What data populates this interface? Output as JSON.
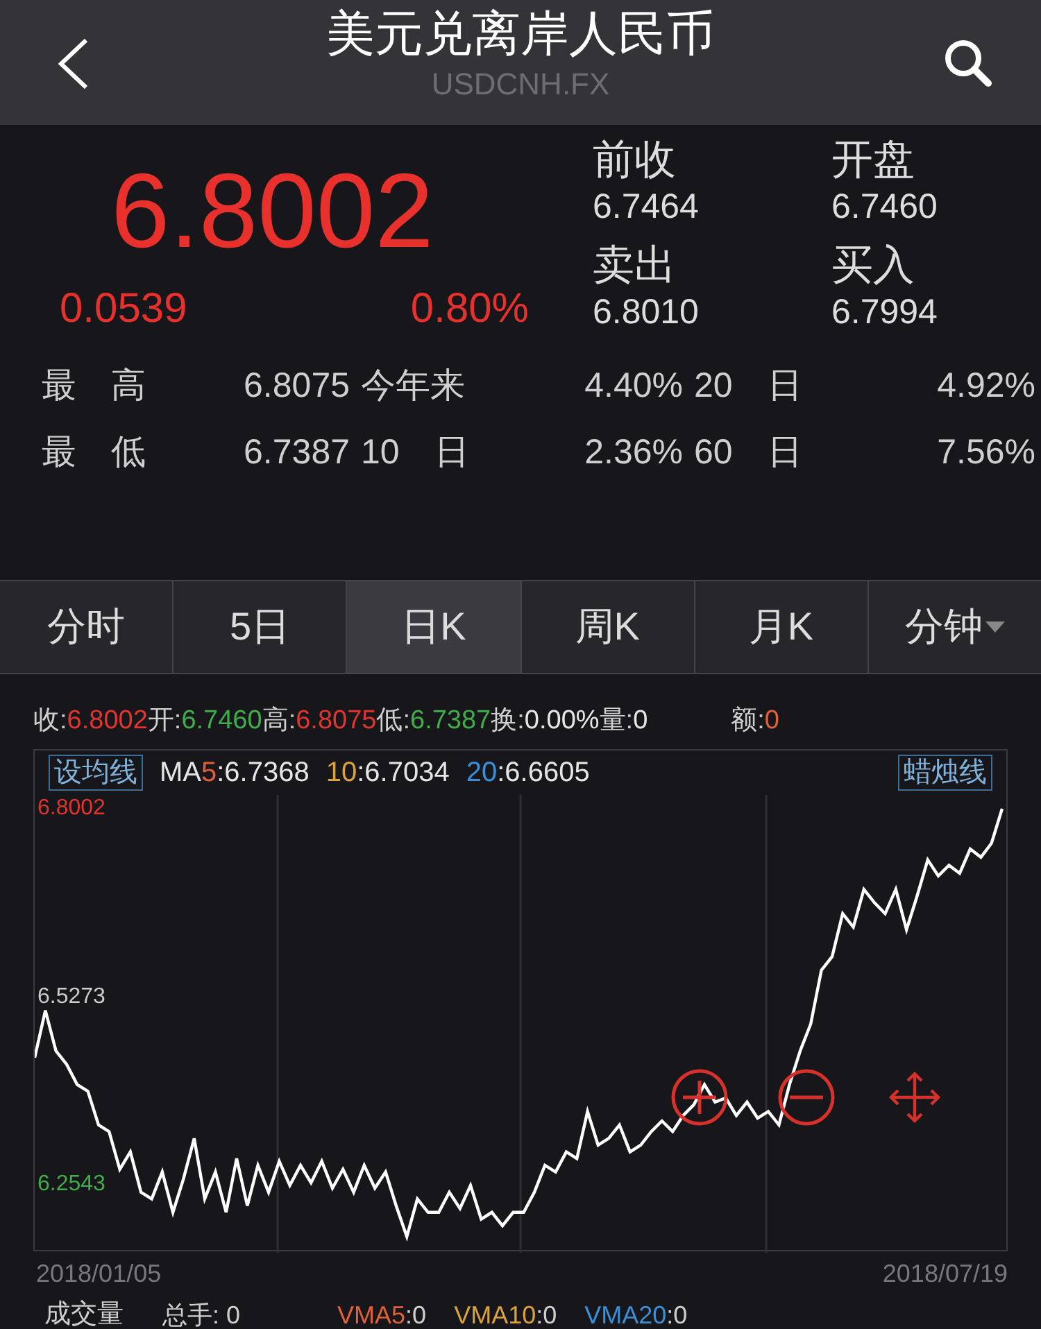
{
  "header": {
    "title": "美元兑离岸人民币",
    "subtitle": "USDCNH.FX"
  },
  "quote": {
    "price": "6.8002",
    "change": "0.0539",
    "change_pct": "0.80%"
  },
  "side_quotes": [
    {
      "label": "前收",
      "value": "6.7464"
    },
    {
      "label": "开盘",
      "value": "6.7460"
    },
    {
      "label": "卖出",
      "value": "6.8010"
    },
    {
      "label": "买入",
      "value": "6.7994"
    }
  ],
  "stats": [
    {
      "label": "最　高",
      "value": "6.8075"
    },
    {
      "label": "今年来",
      "value": "4.40%"
    },
    {
      "label": "20　日",
      "value": "4.92%"
    },
    {
      "label": "最　低",
      "value": "6.7387"
    },
    {
      "label": "10　日",
      "value": "2.36%"
    },
    {
      "label": "60　日",
      "value": "7.56%"
    }
  ],
  "tabs": [
    {
      "label": "分时",
      "selected": false
    },
    {
      "label": "5日",
      "selected": false
    },
    {
      "label": "日K",
      "selected": true
    },
    {
      "label": "周K",
      "selected": false
    },
    {
      "label": "月K",
      "selected": false
    },
    {
      "label": "分钟",
      "selected": false,
      "dropdown": true
    }
  ],
  "info_bar": [
    {
      "label": "收:",
      "value": "6.8002",
      "color": "#e0342f"
    },
    {
      "label": "开:",
      "value": "6.7460",
      "color": "#3fae4a"
    },
    {
      "label": "高:",
      "value": "6.8075",
      "color": "#e0342f"
    },
    {
      "label": "低:",
      "value": "6.7387",
      "color": "#3fae4a"
    },
    {
      "label": "换:",
      "value": "0.00%",
      "color": "#e6e6e6"
    },
    {
      "label": "量:",
      "value": "0",
      "color": "#e6e6e6"
    },
    {
      "label": "额:",
      "value": "0",
      "color": "#e0603a"
    }
  ],
  "ma_bar": {
    "left_button": "设均线",
    "right_button": "蜡烛线",
    "items": [
      {
        "prefix": "MA",
        "num": "5",
        "value": ":6.7368",
        "color": "#e0603a"
      },
      {
        "num": "10",
        "value": ":6.7034",
        "color": "#d9a23a"
      },
      {
        "num": "20",
        "value": ":6.6605",
        "color": "#3a8fd9"
      }
    ]
  },
  "chart_axis": {
    "y_tick_colors": [
      {
        "color": "#e0342f"
      },
      {
        "color": "#cccccc"
      },
      {
        "color": "#3fae4a"
      }
    ],
    "start_date": "2018/01/05",
    "end_date": "2018/07/19"
  },
  "chart_data": {
    "type": "line",
    "ylim": [
      6.1568,
      6.8202
    ],
    "yticks": [
      {
        "value": 6.8002,
        "label": "6.8002"
      },
      {
        "value": 6.5273,
        "label": "6.5273"
      },
      {
        "value": 6.2543,
        "label": "6.2543"
      }
    ],
    "series": [
      {
        "color": "#ffffff",
        "values": [
          6.4395,
          6.5077,
          6.4492,
          6.4297,
          6.4005,
          6.3907,
          6.342,
          6.3322,
          6.2776,
          6.303,
          6.2445,
          6.2347,
          6.2737,
          6.2152,
          6.264,
          6.3225,
          6.2347,
          6.2737,
          6.2152,
          6.2932,
          6.225,
          6.2835,
          6.2445,
          6.2893,
          6.2542,
          6.2835,
          6.2581,
          6.2893,
          6.2503,
          6.2776,
          6.2445,
          6.2835,
          6.2503,
          6.2737,
          6.225,
          6.1801,
          6.2347,
          6.2152,
          6.2152,
          6.2445,
          6.221,
          6.2542,
          6.2054,
          6.2152,
          6.1957,
          6.2152,
          6.2152,
          6.2445,
          6.2835,
          6.2737,
          6.303,
          6.2932,
          6.3614,
          6.3127,
          6.3225,
          6.342,
          6.303,
          6.3127,
          6.3322,
          6.3478,
          6.3322,
          6.3556,
          6.3712,
          6.4005,
          6.3751,
          6.381,
          6.3556,
          6.3751,
          6.3517,
          6.3614,
          6.342,
          6.4005,
          6.4492,
          6.4882,
          6.5662,
          6.5857,
          6.6481,
          6.6286,
          6.6832,
          6.6637,
          6.6481,
          6.6832,
          6.6247,
          6.6734,
          6.7261,
          6.7027,
          6.7183,
          6.7066,
          6.7417,
          6.73,
          6.75,
          6.8002
        ]
      }
    ]
  },
  "volume_bar": {
    "title": "成交量",
    "total": "总手: 0",
    "items": [
      {
        "name": "VMA5",
        "value": ":0",
        "color": "#e0603a"
      },
      {
        "name": "VMA10",
        "value": ":0",
        "color": "#d9a23a"
      },
      {
        "name": "VMA20",
        "value": ":0",
        "color": "#3a8fd9"
      }
    ]
  }
}
